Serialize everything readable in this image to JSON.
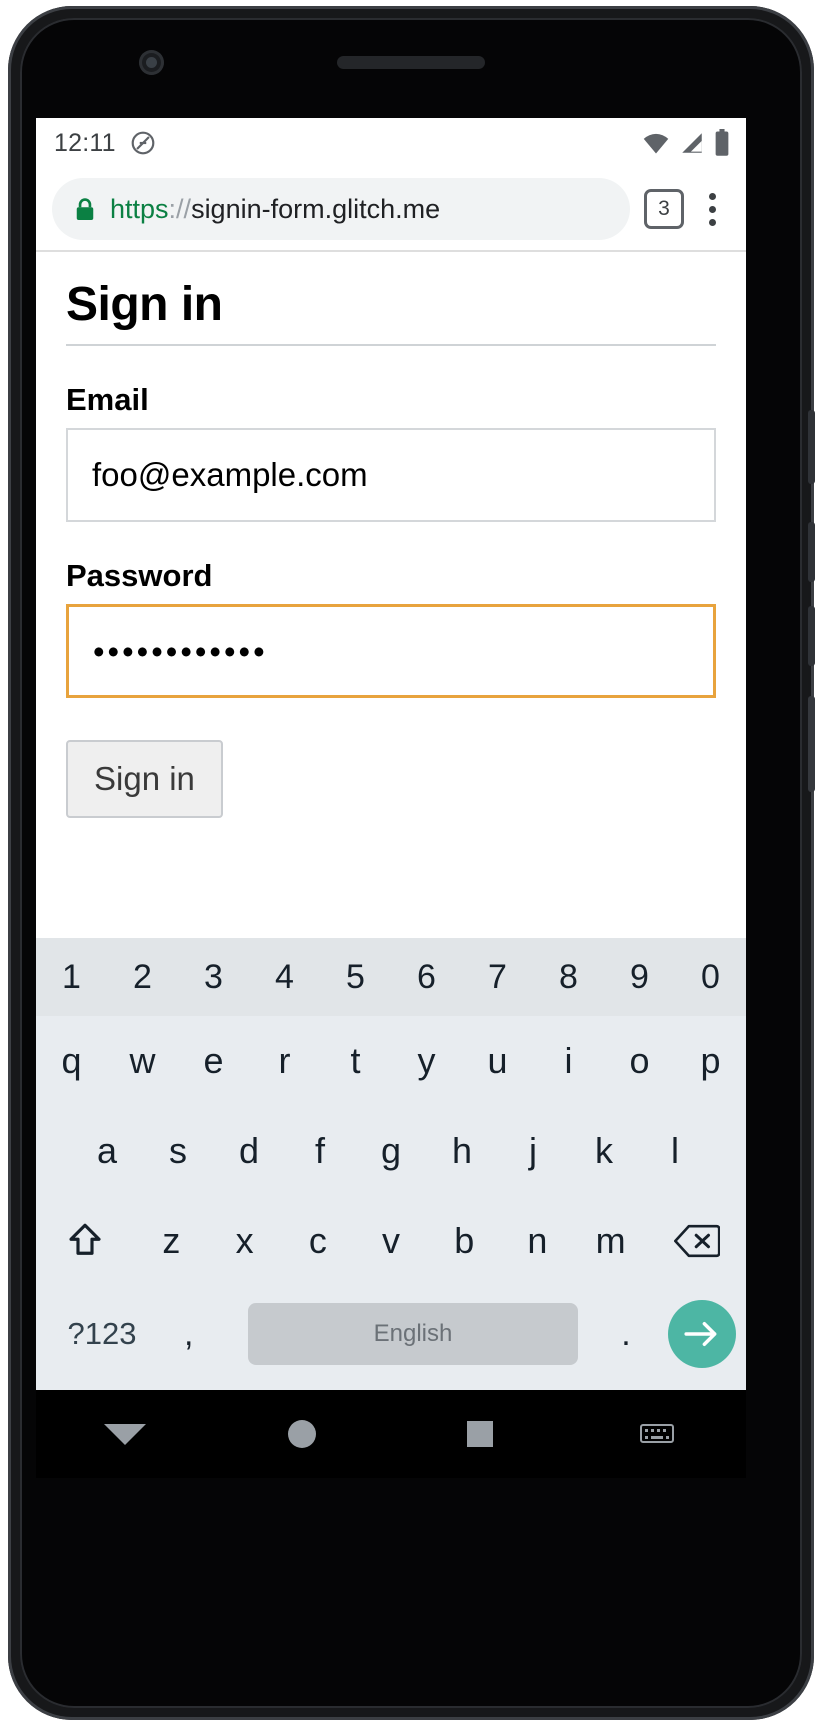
{
  "status_bar": {
    "time": "12:11",
    "icons": [
      "do-not-disturb-icon",
      "wifi-icon",
      "signal-icon",
      "battery-icon"
    ]
  },
  "browser": {
    "url_scheme": "https",
    "url_separator": "://",
    "url_host": "signin-form.glitch.me",
    "full_url": "https://signin-form.glitch.me",
    "tab_count": "3",
    "lock_icon": "lock-icon",
    "menu_icon": "overflow-menu-icon"
  },
  "page": {
    "title": "Sign in",
    "email": {
      "label": "Email",
      "value": "foo@example.com"
    },
    "password": {
      "label": "Password",
      "value": "••••••••••••",
      "focused": true,
      "focus_color": "#e8a33d"
    },
    "submit": {
      "label": "Sign in"
    }
  },
  "keyboard": {
    "number_row": [
      "1",
      "2",
      "3",
      "4",
      "5",
      "6",
      "7",
      "8",
      "9",
      "0"
    ],
    "row1": [
      "q",
      "w",
      "e",
      "r",
      "t",
      "y",
      "u",
      "i",
      "o",
      "p"
    ],
    "row2": [
      "a",
      "s",
      "d",
      "f",
      "g",
      "h",
      "j",
      "k",
      "l"
    ],
    "row3": [
      "z",
      "x",
      "c",
      "v",
      "b",
      "n",
      "m"
    ],
    "shift_icon": "shift-key-icon",
    "backspace_icon": "backspace-key-icon",
    "symbols_key": "?123",
    "comma_key": ",",
    "space_key_label": "English",
    "period_key": ".",
    "enter_icon": "enter-arrow-icon",
    "enter_color": "#4db6a4"
  },
  "nav_bar": {
    "back": "back-nav-icon",
    "home": "home-nav-icon",
    "recents": "recents-nav-icon",
    "hide_keyboard": "hide-keyboard-icon"
  }
}
